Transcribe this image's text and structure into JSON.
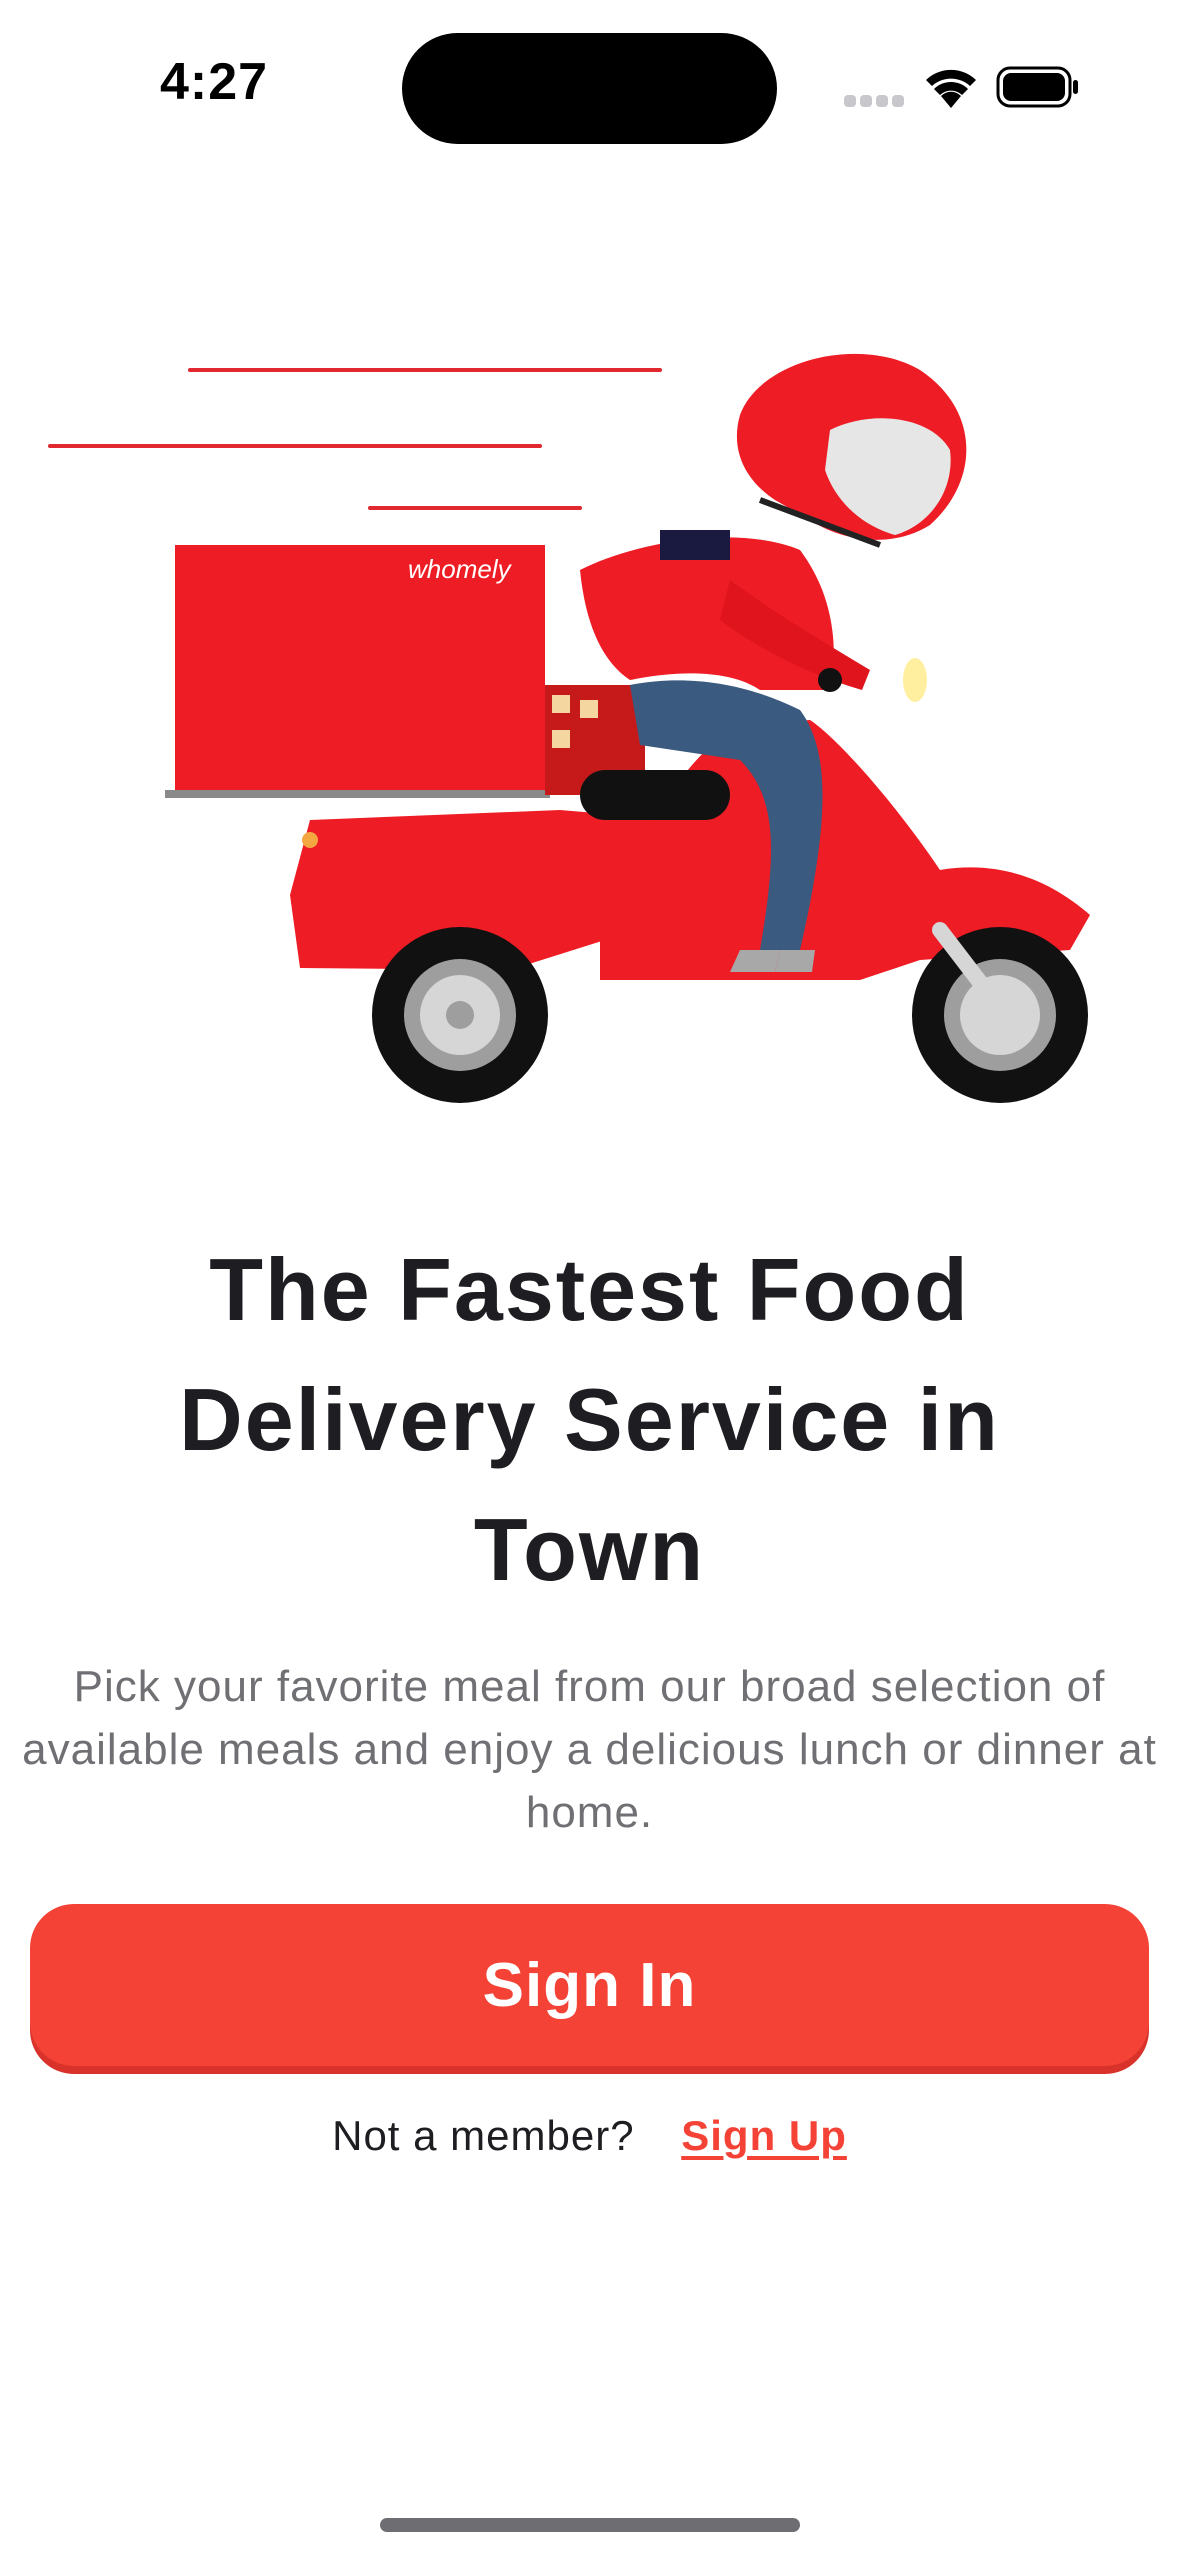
{
  "status_bar": {
    "time": "4:27",
    "signal_icon": "cellular-signal-icon",
    "wifi_icon": "wifi-icon",
    "battery_icon": "battery-icon"
  },
  "hero": {
    "illustration": "delivery-scooter-illustration",
    "brand_label": "whomely",
    "colors": {
      "brand_red": "#ee1c24",
      "denim": "#3b5a80"
    }
  },
  "welcome": {
    "title": "The Fastest Food Delivery Service in Town",
    "description": "Pick your favorite meal from our broad selection of available meals and enjoy a delicious lunch or dinner at home."
  },
  "actions": {
    "signin_label": "Sign In",
    "member_prompt": "Not a member?",
    "signup_label": "Sign Up"
  },
  "theme": {
    "accent": "#f44336",
    "text_primary": "#1e1e22",
    "text_secondary": "#707074"
  }
}
